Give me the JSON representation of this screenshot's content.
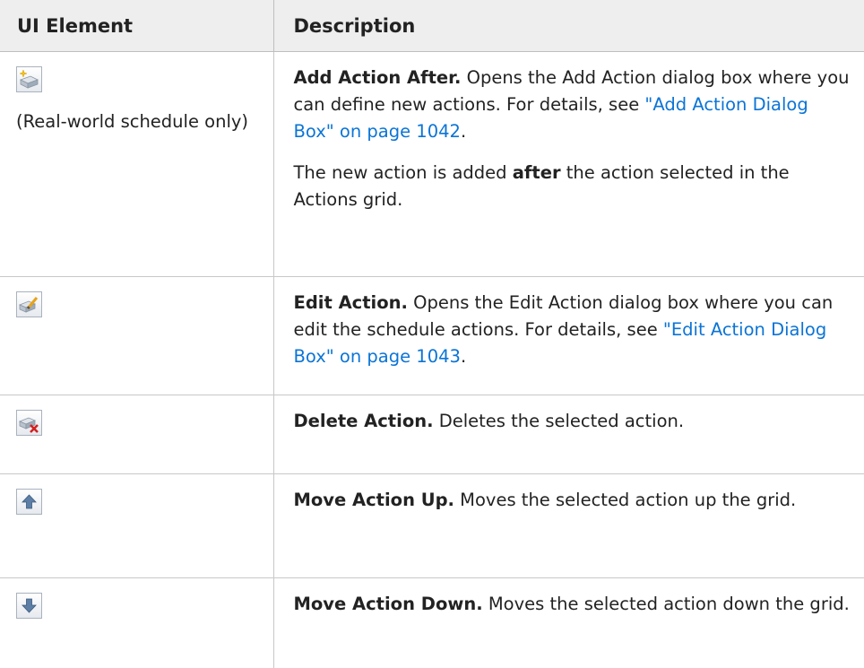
{
  "table": {
    "headers": {
      "element": "UI Element",
      "description": "Description"
    },
    "rows": {
      "add_action": {
        "icon": "add-action-icon",
        "note": "(Real-world schedule only)",
        "term": "Add Action After.",
        "text": " Opens the Add Action dialog box where you can define new actions. For details, see ",
        "link": "\"Add Action Dialog Box\" on page 1042",
        "text_end": ".",
        "para2_a": "The new action is added ",
        "para2_bold": "after",
        "para2_b": " the action selected in the Actions grid."
      },
      "edit_action": {
        "icon": "edit-action-icon",
        "term": "Edit Action.",
        "text": " Opens the Edit Action dialog box where you can edit the schedule actions. For details, see ",
        "link": "\"Edit Action Dialog Box\" on page 1043",
        "text_end": "."
      },
      "delete_action": {
        "icon": "delete-action-icon",
        "term": "Delete Action.",
        "text": " Deletes the selected action."
      },
      "move_up": {
        "icon": "arrow-up-icon",
        "term": "Move Action Up.",
        "text": " Moves the selected action up the grid."
      },
      "move_down": {
        "icon": "arrow-down-icon",
        "term": "Move Action Down.",
        "text": " Moves the selected action down the grid."
      }
    }
  },
  "colors": {
    "header_bg": "#eeeeee",
    "link": "#0b74d6",
    "border": "#c8c8c8"
  }
}
